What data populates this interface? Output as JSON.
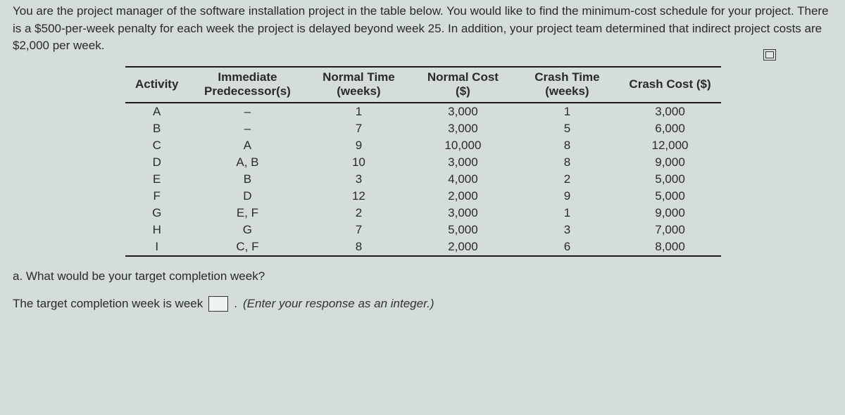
{
  "problem": {
    "text": "You are the project manager of the software installation project in the table below. You would like to find the minimum-cost schedule for your project. There is a $500-per-week penalty for each week the project is delayed beyond week 25. In addition, your project team determined that indirect project costs are $2,000 per week."
  },
  "table": {
    "headers": {
      "activity": "Activity",
      "predecessor": "Immediate Predecessor(s)",
      "normal_time": "Normal Time (weeks)",
      "normal_cost": "Normal Cost ($)",
      "crash_time": "Crash Time (weeks)",
      "crash_cost": "Crash Cost ($)"
    },
    "rows": [
      {
        "activity": "A",
        "pred": "–",
        "nt": "1",
        "nc": "3,000",
        "ct": "1",
        "cc": "3,000"
      },
      {
        "activity": "B",
        "pred": "–",
        "nt": "7",
        "nc": "3,000",
        "ct": "5",
        "cc": "6,000"
      },
      {
        "activity": "C",
        "pred": "A",
        "nt": "9",
        "nc": "10,000",
        "ct": "8",
        "cc": "12,000"
      },
      {
        "activity": "D",
        "pred": "A, B",
        "nt": "10",
        "nc": "3,000",
        "ct": "8",
        "cc": "9,000"
      },
      {
        "activity": "E",
        "pred": "B",
        "nt": "3",
        "nc": "4,000",
        "ct": "2",
        "cc": "5,000"
      },
      {
        "activity": "F",
        "pred": "D",
        "nt": "12",
        "nc": "2,000",
        "ct": "9",
        "cc": "5,000"
      },
      {
        "activity": "G",
        "pred": "E, F",
        "nt": "2",
        "nc": "3,000",
        "ct": "1",
        "cc": "9,000"
      },
      {
        "activity": "H",
        "pred": "G",
        "nt": "7",
        "nc": "5,000",
        "ct": "3",
        "cc": "7,000"
      },
      {
        "activity": "I",
        "pred": "C, F",
        "nt": "8",
        "nc": "2,000",
        "ct": "6",
        "cc": "8,000"
      }
    ]
  },
  "question_a": {
    "label": "a.",
    "text": "What would be your target completion week?"
  },
  "answer": {
    "prefix": "The target completion week is week",
    "hint": "(Enter your response as an integer.)",
    "value": ""
  }
}
